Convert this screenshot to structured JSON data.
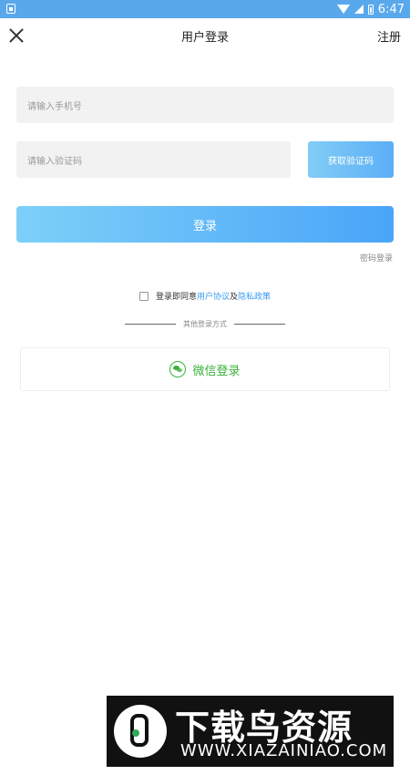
{
  "status_bar": {
    "time": "6:47",
    "icons": [
      "app-notification-icon",
      "wifi-icon",
      "signal-icon",
      "battery-icon"
    ]
  },
  "header": {
    "title": "用户登录",
    "register_label": "注册",
    "close_icon": "close-icon"
  },
  "form": {
    "phone_placeholder": "请输入手机号",
    "code_placeholder": "请输入验证码",
    "get_code_label": "获取验证码",
    "login_label": "登录",
    "password_login_label": "密码登录"
  },
  "agreement": {
    "prefix": "登录即同意",
    "user_agreement": "用户协议",
    "and": "及",
    "privacy_policy": "隐私政策"
  },
  "other_login": {
    "label": "其他登录方式",
    "wechat_label": "微信登录"
  },
  "watermark": {
    "title": "下载鸟资源",
    "url": "WWW.XIAZAINIAO.COM"
  },
  "colors": {
    "status_bar": "#5aa8ec",
    "accent_blue": "#4aa5f8",
    "wechat_green": "#3bb13b",
    "link": "#3a9bf0"
  }
}
